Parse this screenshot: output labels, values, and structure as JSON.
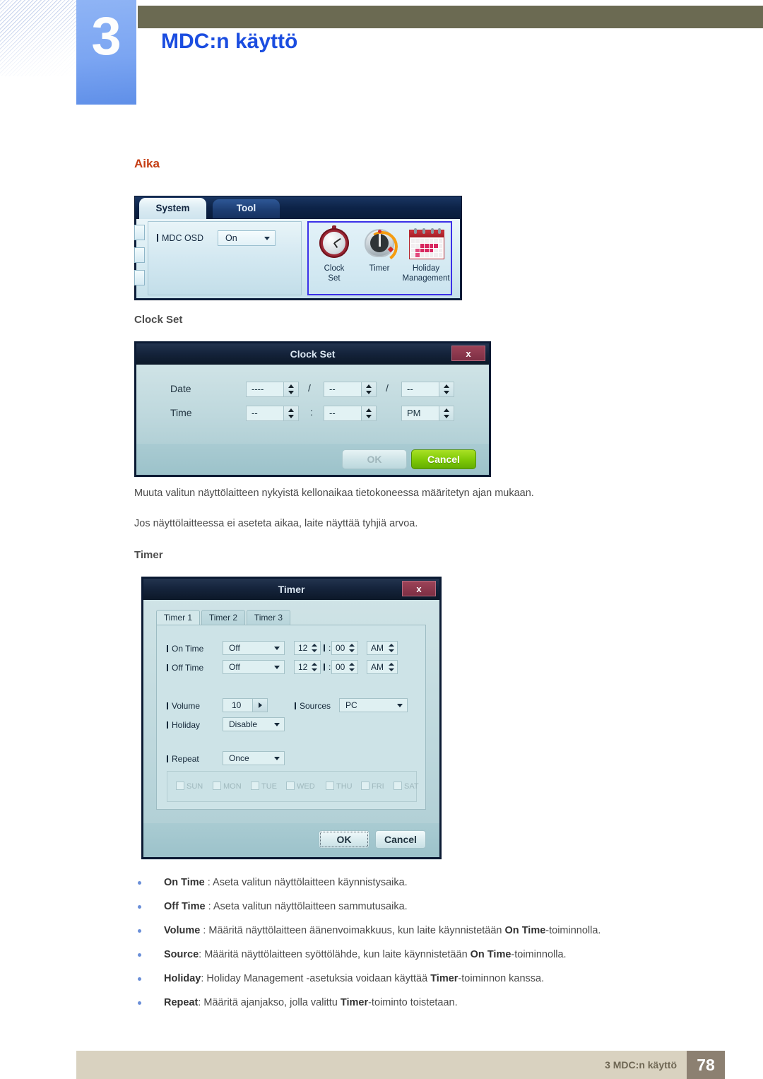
{
  "header": {
    "chapter_number": "3",
    "chapter_title": "MDC:n käyttö"
  },
  "section": {
    "title": "Aika"
  },
  "mdc_ribbon": {
    "tabs": [
      "System",
      "Tool"
    ],
    "field_label": "MDC OSD",
    "field_value": "On",
    "icons": [
      {
        "name": "Clock",
        "name2": "Set"
      },
      {
        "name": "Timer",
        "name2": ""
      },
      {
        "name": "Holiday",
        "name2": "Management"
      }
    ]
  },
  "clock_set": {
    "heading": "Clock Set",
    "dialog_title": "Clock Set",
    "close_label": "x",
    "row_date_label": "Date",
    "row_time_label": "Time",
    "date_year": "----",
    "date_month": "--",
    "date_day": "--",
    "date_sep1": "/",
    "date_sep2": "/",
    "time_hour": "--",
    "time_min": "--",
    "time_ampm": "PM",
    "time_sep": ":",
    "ok_label": "OK",
    "cancel_label": "Cancel"
  },
  "paragraphs": [
    "Muuta valitun näyttölaitteen nykyistä kellonaikaa tietokoneessa määritetyn ajan mukaan.",
    "Jos näyttölaitteessa ei aseteta aikaa, laite näyttää tyhjiä arvoa."
  ],
  "timer": {
    "heading": "Timer",
    "dialog_title": "Timer",
    "close_label": "x",
    "tabs": [
      "Timer 1",
      "Timer 2",
      "Timer 3"
    ],
    "on_time_label": "On Time",
    "on_time_mode": "Off",
    "on_time_hour": "12",
    "on_time_min": "00",
    "on_time_ampm": "AM",
    "off_time_label": "Off Time",
    "off_time_mode": "Off",
    "off_time_hour": "12",
    "off_time_min": "00",
    "off_time_ampm": "AM",
    "time_sep": ":",
    "volume_label": "Volume",
    "volume_value": "10",
    "sources_label": "Sources",
    "sources_value": "PC",
    "holiday_label": "Holiday",
    "holiday_value": "Disable",
    "repeat_label": "Repeat",
    "repeat_value": "Once",
    "days": [
      "SUN",
      "MON",
      "TUE",
      "WED",
      "THU",
      "FRI",
      "SAT"
    ],
    "ok_label": "OK",
    "cancel_label": "Cancel"
  },
  "bullets": [
    {
      "term": "On Time",
      "rest": " : Aseta valitun näyttölaitteen käynnistysaika.",
      "bold_tail": "",
      "tail": ""
    },
    {
      "term": "Off Time",
      "rest": " : Aseta valitun näyttölaitteen sammutusaika.",
      "bold_tail": "",
      "tail": ""
    },
    {
      "term": "Volume",
      "rest": " : Määritä näyttölaitteen äänenvoimakkuus, kun laite käynnistetään ",
      "bold_tail": "On Time",
      "tail": "-toiminnolla."
    },
    {
      "term": "Source",
      "rest": ": Määritä näyttölaitteen syöttölähde, kun laite käynnistetään ",
      "bold_tail": "On Time",
      "tail": "-toiminnolla."
    },
    {
      "term": "Holiday",
      "rest": ": Holiday Management -asetuksia voidaan käyttää ",
      "bold_tail": "Timer",
      "tail": "-toiminnon kanssa."
    },
    {
      "term": "Repeat",
      "rest": ": Määritä ajanjakso, jolla valittu ",
      "bold_tail": "Timer",
      "tail": "-toiminto toistetaan."
    }
  ],
  "footer": {
    "text": "3 MDC:n käyttö",
    "page": "78"
  },
  "colors": {
    "accent_orange": "#c43c12",
    "chapter_blue": "#1b4de0",
    "tab_blue": "#7ba5f2",
    "olive": "#6b6a52",
    "footer_bg": "#d9d2c0",
    "page_box": "#8c8071"
  }
}
